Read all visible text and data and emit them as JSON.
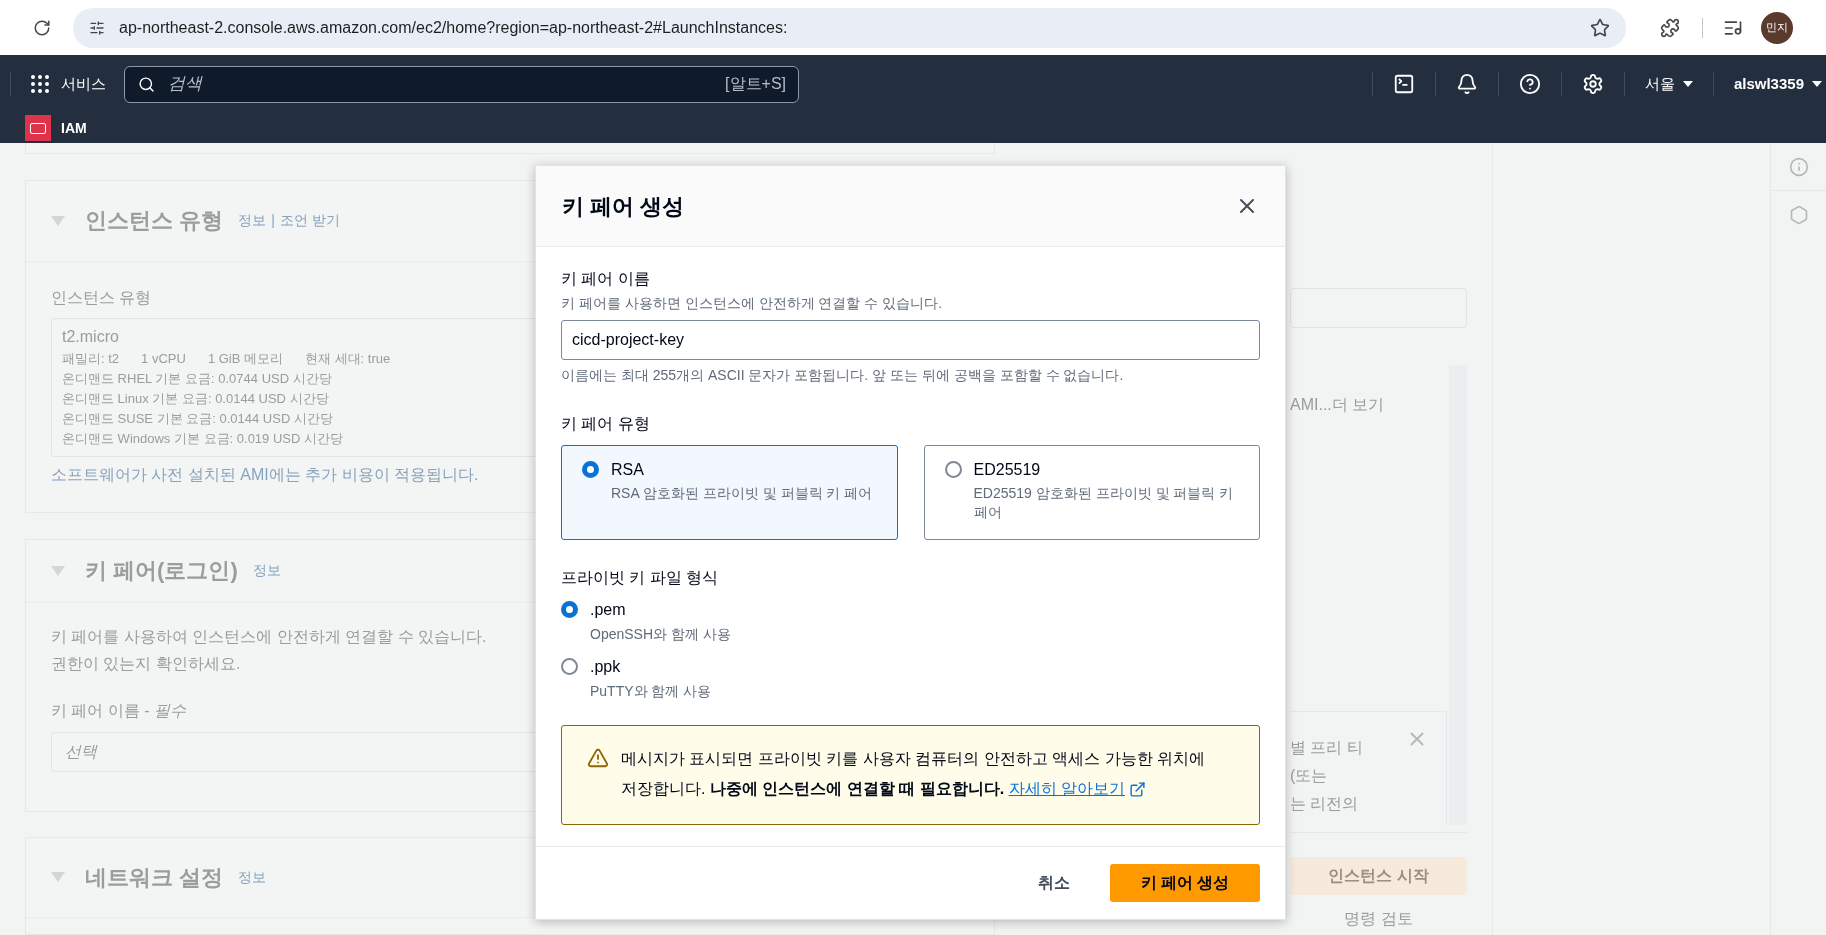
{
  "browser": {
    "url": "ap-northeast-2.console.aws.amazon.com/ec2/home?region=ap-northeast-2#LaunchInstances:",
    "profile": "민지"
  },
  "nav": {
    "services": "서비스",
    "search_placeholder": "검색",
    "search_shortcut": "[알트+S]",
    "region": "서울",
    "user": "alswl3359"
  },
  "favorites": [
    {
      "label": "IAM"
    }
  ],
  "instance_type_section": {
    "title": "인스턴스 유형",
    "links": [
      "정보",
      "조언 받기"
    ],
    "separator": "|",
    "field_label": "인스턴스 유형",
    "selected_type": "t2.micro",
    "specs": [
      "패밀리: t2",
      "1 vCPU",
      "1 GiB 메모리",
      "현재 세대: true"
    ],
    "prices": [
      "온디맨드 RHEL 기본 요금: 0.0744 USD 시간당",
      "온디맨드 Linux 기본 요금: 0.0144 USD 시간당",
      "온디맨드 SUSE 기본 요금: 0.0144 USD 시간당",
      "온디맨드 Windows 기본 요금: 0.019 USD 시간당"
    ],
    "note": "소프트웨어가 사전 설치된 AMI에는 추가 비용이 적용됩니다."
  },
  "key_pair_section": {
    "title": "키 페어(로그인)",
    "info": "정보",
    "description": [
      "키 페어를 사용하여 인스턴스에 안전하게 연결할 수 있습니다.",
      "권한이 있는지 확인하세요."
    ],
    "field_label": "키 페어 이름 - *필수*",
    "placeholder": "선택"
  },
  "network_section": {
    "title": "네트워크 설정",
    "info": "정보"
  },
  "summary_panel": {
    "ami_more": "AMI...더 보기",
    "free_tier_lines": [
      "별 프리 티",
      "(또는",
      "는 리전의"
    ],
    "launch_button": "인스턴스 시작",
    "review_link": "명령 검토"
  },
  "modal": {
    "title": "키 페어 생성",
    "name_label": "키 페어 이름",
    "name_description": "키 페어를 사용하면 인스턴스에 안전하게 연결할 수 있습니다.",
    "name_value": "cicd-project-key",
    "name_hint": "이름에는 최대 255개의 ASCII 문자가 포함됩니다. 앞 또는 뒤에 공백을 포함할 수 없습니다.",
    "type_label": "키 페어 유형",
    "key_types": [
      {
        "label": "RSA",
        "description": "RSA 암호화된 프라이빗 및 퍼블릭 키 페어",
        "selected": true
      },
      {
        "label": "ED25519",
        "description": "ED25519 암호화된 프라이빗 및 퍼블릭 키 페어",
        "selected": false
      }
    ],
    "format_label": "프라이빗 키 파일 형식",
    "formats": [
      {
        "label": ".pem",
        "description": "OpenSSH와 함께 사용",
        "selected": true
      },
      {
        "label": ".ppk",
        "description": "PuTTY와 함께 사용",
        "selected": false
      }
    ],
    "warning": "메시지가 표시되면 프라이빗 키를 사용자 컴퓨터의 안전하고 액세스 가능한 위치에 저장합니다. **나중에 인스턴스에 연결할 때 필요합니다.**",
    "warning_link": "자세히 알아보기",
    "cancel": "취소",
    "submit": "키 페어 생성"
  }
}
